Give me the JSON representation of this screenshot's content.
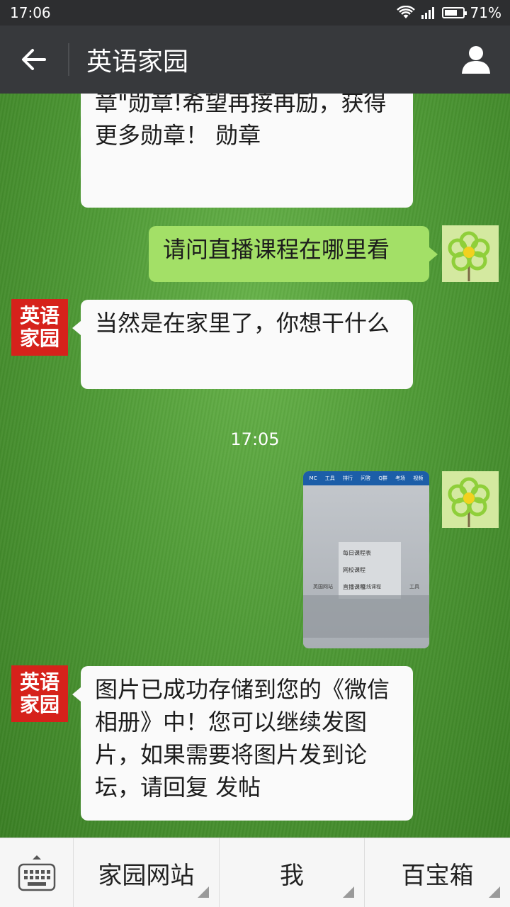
{
  "status_bar": {
    "time": "17:06",
    "battery_percent": "71%",
    "battery_level": 0.71,
    "icons": [
      "wifi-icon",
      "signal-icon",
      "battery-icon"
    ]
  },
  "header": {
    "title": "英语家园",
    "icons": [
      "back-arrow-icon",
      "profile-icon"
    ]
  },
  "avatars": {
    "brand_line1": "英语",
    "brand_line2": "家园",
    "brand_color": "#d6221b",
    "user_icon": "flower-icon"
  },
  "messages": {
    "m1": "章\"勋章!希望再接再励，获得更多勋章！ 勋章",
    "m2": "请问直播课程在哪里看",
    "m3": "当然是在家里了，你想干什么",
    "timestamp": "17:05",
    "m5": "图片已成功存储到您的《微信相册》中！您可以继续发图片，如果需要将图片发到论坛，请回复 发帖"
  },
  "image_thumb": {
    "nav_items": [
      "MC",
      "工具",
      "排行",
      "问答",
      "Q群",
      "考场",
      "视频"
    ],
    "menu_items": [
      "每日课程表",
      "网校课程",
      "直播课程"
    ],
    "row_items": [
      "英国网站",
      "在线课程",
      "工具"
    ]
  },
  "colors": {
    "title_bar": "#37393c",
    "sent_bubble": "#a3e067",
    "received_bubble": "#fafafa"
  },
  "bottom_bar": {
    "keyboard_icon": "keyboard-icon",
    "menus": [
      "家园网站",
      "我",
      "百宝箱"
    ]
  }
}
